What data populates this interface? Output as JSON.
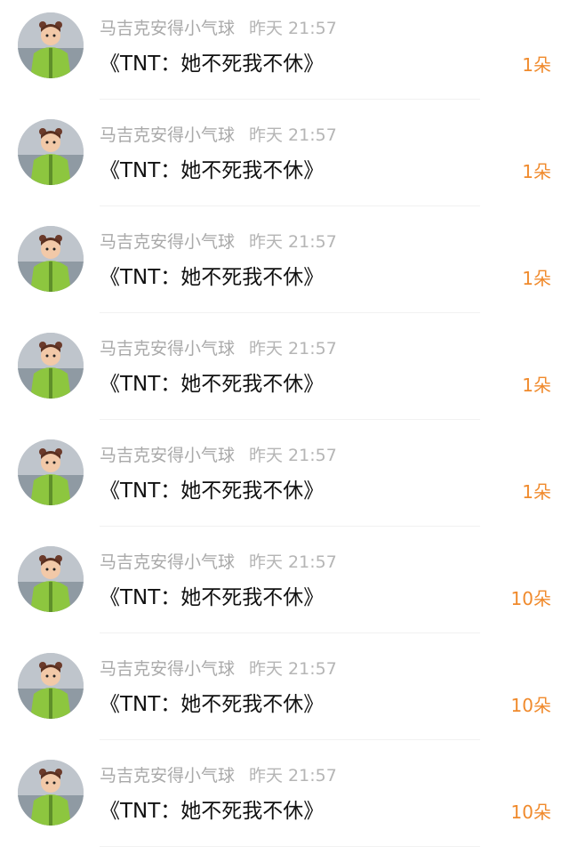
{
  "colors": {
    "username": "#a9a9a9",
    "timestamp": "#b5b5b5",
    "title": "#111111",
    "count": "#f08a2c",
    "divider": "#f1f1f1"
  },
  "rows": [
    {
      "username": "马吉克安得小气球",
      "time": "昨天 21:57",
      "title": "《TNT：她不死我不休》",
      "count": "1朵",
      "avatar_icon": "child-in-green-jacket-avatar"
    },
    {
      "username": "马吉克安得小气球",
      "time": "昨天 21:57",
      "title": "《TNT：她不死我不休》",
      "count": "1朵",
      "avatar_icon": "child-in-green-jacket-avatar"
    },
    {
      "username": "马吉克安得小气球",
      "time": "昨天 21:57",
      "title": "《TNT：她不死我不休》",
      "count": "1朵",
      "avatar_icon": "child-in-green-jacket-avatar"
    },
    {
      "username": "马吉克安得小气球",
      "time": "昨天 21:57",
      "title": "《TNT：她不死我不休》",
      "count": "1朵",
      "avatar_icon": "child-in-green-jacket-avatar"
    },
    {
      "username": "马吉克安得小气球",
      "time": "昨天 21:57",
      "title": "《TNT：她不死我不休》",
      "count": "1朵",
      "avatar_icon": "child-in-green-jacket-avatar"
    },
    {
      "username": "马吉克安得小气球",
      "time": "昨天 21:57",
      "title": "《TNT：她不死我不休》",
      "count": "10朵",
      "avatar_icon": "child-in-green-jacket-avatar"
    },
    {
      "username": "马吉克安得小气球",
      "time": "昨天 21:57",
      "title": "《TNT：她不死我不休》",
      "count": "10朵",
      "avatar_icon": "child-in-green-jacket-avatar"
    },
    {
      "username": "马吉克安得小气球",
      "time": "昨天 21:57",
      "title": "《TNT：她不死我不休》",
      "count": "10朵",
      "avatar_icon": "child-in-green-jacket-avatar"
    }
  ]
}
